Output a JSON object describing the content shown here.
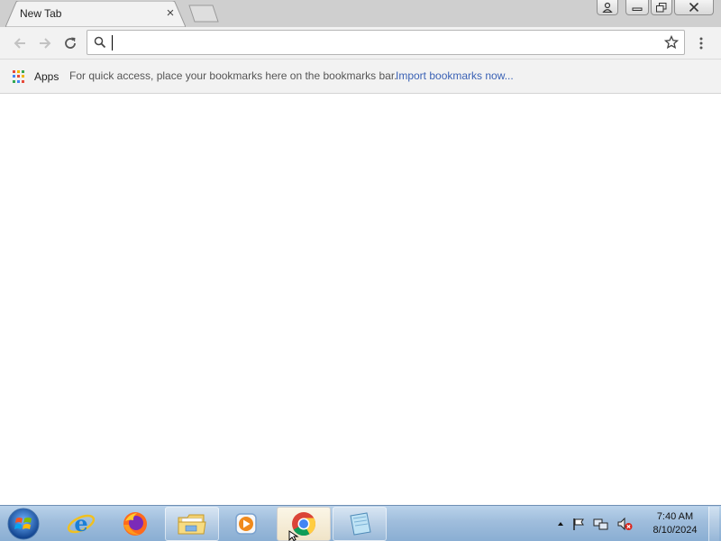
{
  "browser": {
    "tab": {
      "title": "New Tab",
      "close_glyph": "×"
    },
    "omnibox": {
      "value": "",
      "placeholder": ""
    },
    "bookmarks_bar": {
      "apps_label": "Apps",
      "message": "For quick access, place your bookmarks here on the bookmarks bar.",
      "import_link": "Import bookmarks now..."
    },
    "icons": [
      "back-icon",
      "forward-icon",
      "reload-icon",
      "search-icon",
      "star-icon",
      "menu-icon",
      "profile-icon",
      "minimize-icon",
      "restore-icon",
      "close-icon",
      "apps-grid-icon"
    ]
  },
  "taskbar": {
    "items": [
      "start-orb",
      "internet-explorer",
      "firefox",
      "windows-explorer",
      "media-player",
      "google-chrome",
      "notepad"
    ],
    "active_item": "google-chrome",
    "tray_icons": [
      "show-hidden-icons",
      "action-center-flag",
      "network",
      "volume-muted"
    ],
    "clock": {
      "time": "7:40 AM",
      "date": "8/10/2024"
    }
  },
  "colors": {
    "titlebar": "#cfcfcf",
    "toolbar": "#f2f2f2",
    "link": "#3b62b5",
    "taskbar": "#9fbddc"
  }
}
